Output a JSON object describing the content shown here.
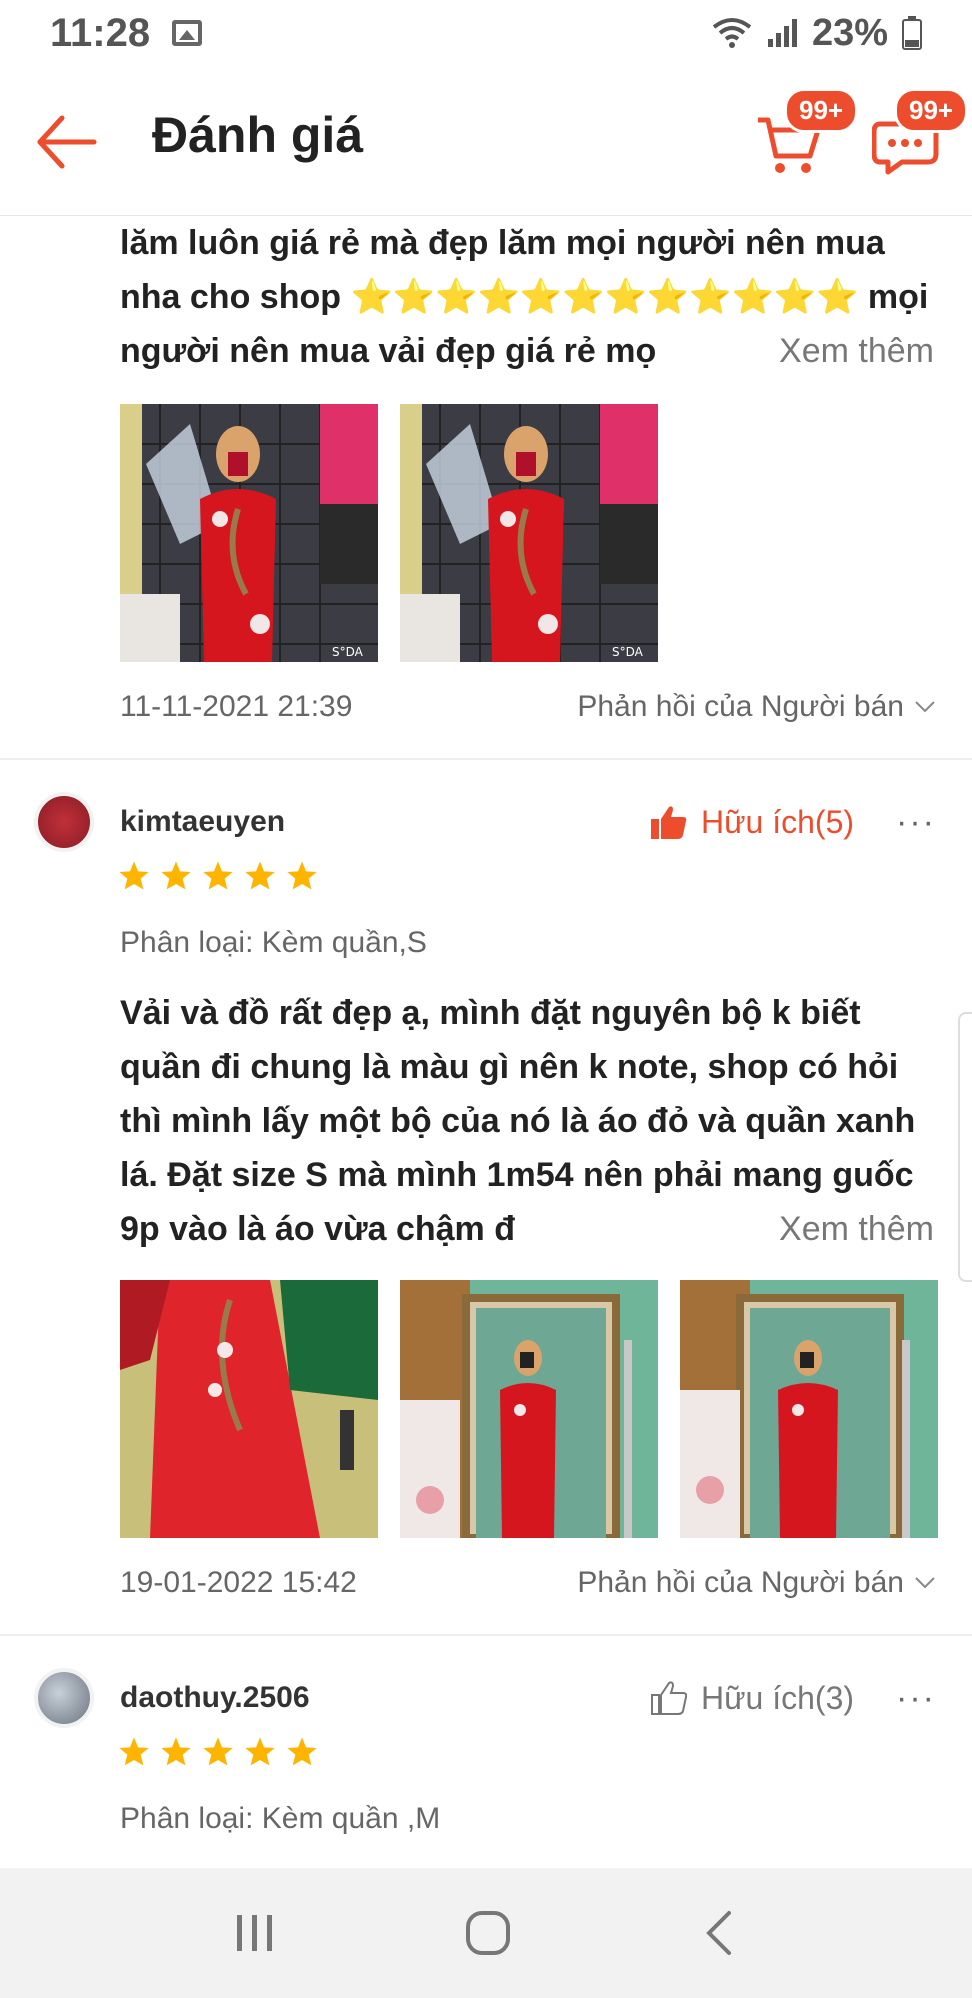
{
  "status_bar": {
    "time": "11:28",
    "battery": "23%"
  },
  "header": {
    "title": "Đánh giá",
    "cart_badge": "99+",
    "chat_badge": "99+"
  },
  "colors": {
    "accent": "#ee4d2d",
    "star": "#ffb400",
    "muted": "#777777"
  },
  "review1": {
    "description": "lăm luôn giá rẻ mà đẹp lăm mọi người nên mua nha cho shop ⭐⭐⭐⭐⭐⭐⭐⭐⭐⭐⭐⭐ mọi người nên mua vải đẹp giá rẻ mọ",
    "see_more": "Xem thêm",
    "date": "11-11-2021 21:39",
    "seller_reply": "Phản hồi của Người bán",
    "photo_watermarks": [
      "S°DA",
      "S°DA"
    ]
  },
  "review2": {
    "username": "kimtaeuyen",
    "helpful": "Hữu ích(5)",
    "rating": 5,
    "variant": "Phân loại: Kèm quần,S",
    "description": "Vải và đồ rất đẹp ạ, mình đặt nguyên bộ k biết quần đi chung là màu gì nên k note, shop có hỏi thì mình lấy một bộ của nó là áo đỏ và quần xanh lá. Đặt size S mà mình 1m54 nên phải mang guốc 9p vào là áo vừa chậm đ",
    "see_more": "Xem thêm",
    "date": "19-01-2022 15:42",
    "seller_reply": "Phản hồi của Người bán"
  },
  "review3": {
    "username": "daothuy.2506",
    "helpful": "Hữu ích(3)",
    "rating": 5,
    "variant": "Phân loại: Kèm quần ,M"
  }
}
